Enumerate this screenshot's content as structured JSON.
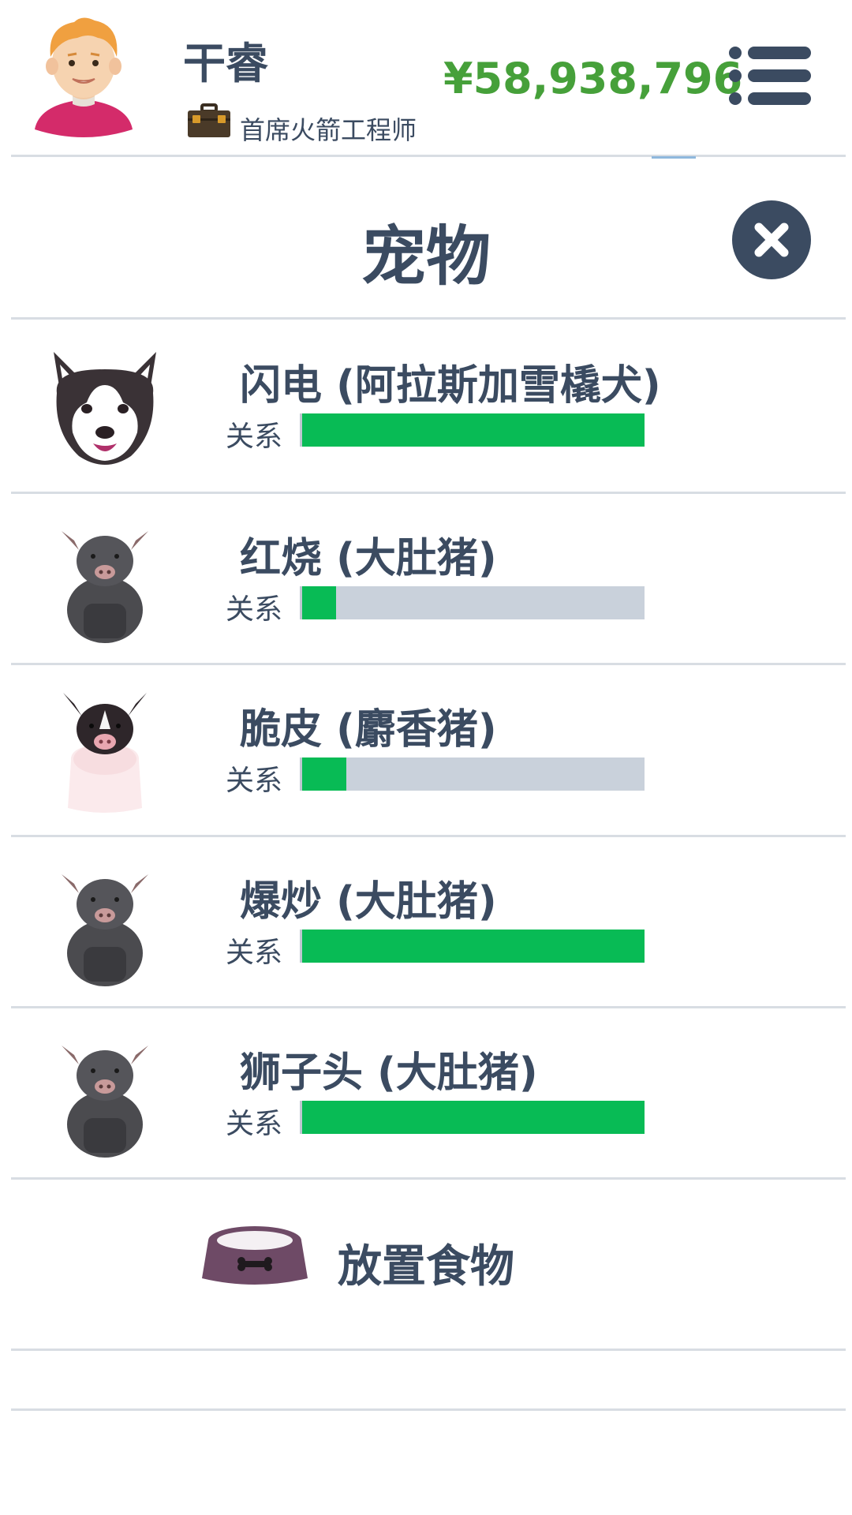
{
  "header": {
    "player_name": "干睿",
    "job_title": "首席火箭工程师",
    "money": "¥58,938,796"
  },
  "pets_panel": {
    "title": "宠物",
    "relation_label": "关系",
    "pets": [
      {
        "name": "闪电 (阿拉斯加雪橇犬)",
        "relationship": 1.0,
        "icon": "husky-icon"
      },
      {
        "name": "红烧 (大肚猪)",
        "relationship": 0.1,
        "icon": "pot-bellied-pig-icon"
      },
      {
        "name": "脆皮 (麝香猪)",
        "relationship": 0.13,
        "icon": "musk-pig-icon"
      },
      {
        "name": "爆炒 (大肚猪)",
        "relationship": 1.0,
        "icon": "pot-bellied-pig-icon"
      },
      {
        "name": "狮子头 (大肚猪)",
        "relationship": 1.0,
        "icon": "pot-bellied-pig-icon"
      }
    ],
    "place_food_label": "放置食物"
  },
  "colors": {
    "text": "#3b4b61",
    "money": "#46a03a",
    "bar_fill": "#08bb55",
    "bar_track": "#c9d1db",
    "close_button": "#3b4b61"
  }
}
